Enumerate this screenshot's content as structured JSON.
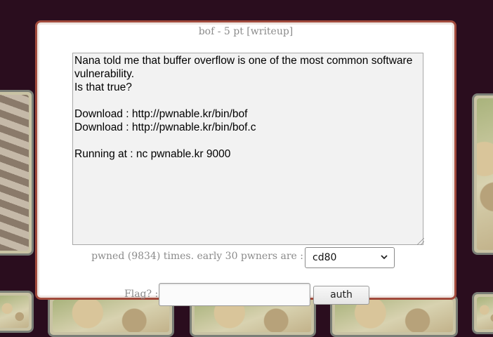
{
  "modal": {
    "title": "bof - 5 pt [writeup]",
    "description": "Nana told me that buffer overflow is one of the most common software vulnerability.\nIs that true?\n\nDownload : http://pwnable.kr/bin/bof\nDownload : http://pwnable.kr/bin/bof.c\n\nRunning at : nc pwnable.kr 9000",
    "pwned_text": "pwned (9834) times. early 30 pwners are :",
    "pwners_select": {
      "selected": "cd80",
      "icon": "chevron-down-icon"
    },
    "flag_label": "Flag? :",
    "flag_value": "",
    "auth_label": "auth"
  },
  "colors": {
    "page_background": "#2a0d1e",
    "modal_border": "#a14a3c",
    "muted_text": "#8b8b8b"
  }
}
